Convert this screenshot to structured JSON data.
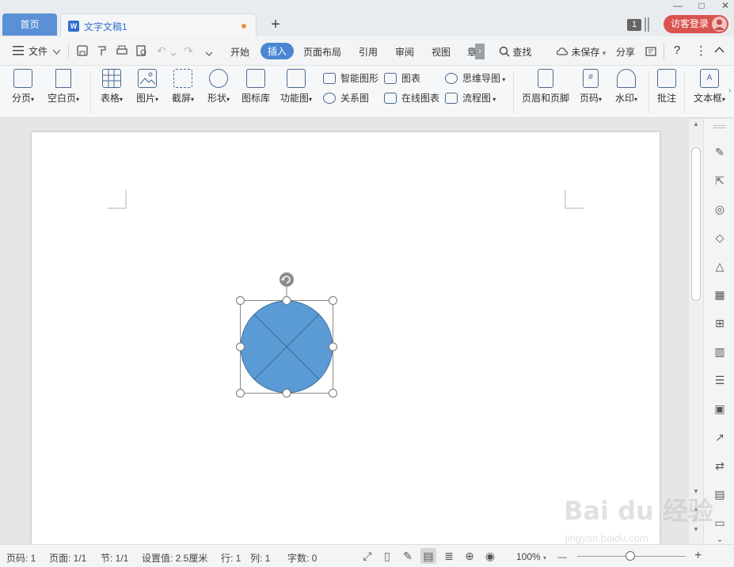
{
  "titlebar": {
    "home_tab": "首页",
    "doc_tab": "文字文稿1",
    "doc_icon_letter": "W",
    "add_tab": "+",
    "notification_count": "1",
    "login_label": "访客登录",
    "window_controls": [
      "—",
      "□",
      "✕"
    ]
  },
  "menu": {
    "file_label": "文件",
    "tabs": [
      "开始",
      "插入",
      "页面布局",
      "引用",
      "审阅",
      "视图",
      "章"
    ],
    "active_tab": "插入",
    "search_label": "查找",
    "unsaved_label": "未保存",
    "share_label": "分享",
    "help_label": "?",
    "more_label": "⋮",
    "collapse_label": "︿"
  },
  "ribbon": {
    "large": [
      {
        "label": "分页"
      },
      {
        "label": "空白页"
      },
      {
        "label": "表格"
      },
      {
        "label": "图片"
      },
      {
        "label": "截屏"
      },
      {
        "label": "形状"
      },
      {
        "label": "图标库"
      },
      {
        "label": "功能图"
      },
      {
        "label": "页眉和页脚"
      },
      {
        "label": "页码"
      },
      {
        "label": "水印"
      },
      {
        "label": "批注"
      },
      {
        "label": "文本框"
      }
    ],
    "small": [
      {
        "label": "智能图形"
      },
      {
        "label": "关系图"
      },
      {
        "label": "图表"
      },
      {
        "label": "在线图表"
      },
      {
        "label": "思维导图"
      },
      {
        "label": "流程图"
      }
    ]
  },
  "shape": {
    "type": "circle-with-cross",
    "fill": "#5b9bd5",
    "stroke": "#41719c"
  },
  "statusbar": {
    "page_num": "页码: 1",
    "pages": "页面: 1/1",
    "section": "节: 1/1",
    "setting": "设置值: 2.5厘米",
    "row": "行: 1",
    "col": "列: 1",
    "words": "字数: 0",
    "zoom": "100%",
    "zoom_minus": "—",
    "zoom_plus": "+"
  },
  "watermark": {
    "brand": "Bai du 经验",
    "url": "jingyan.baidu.com"
  }
}
